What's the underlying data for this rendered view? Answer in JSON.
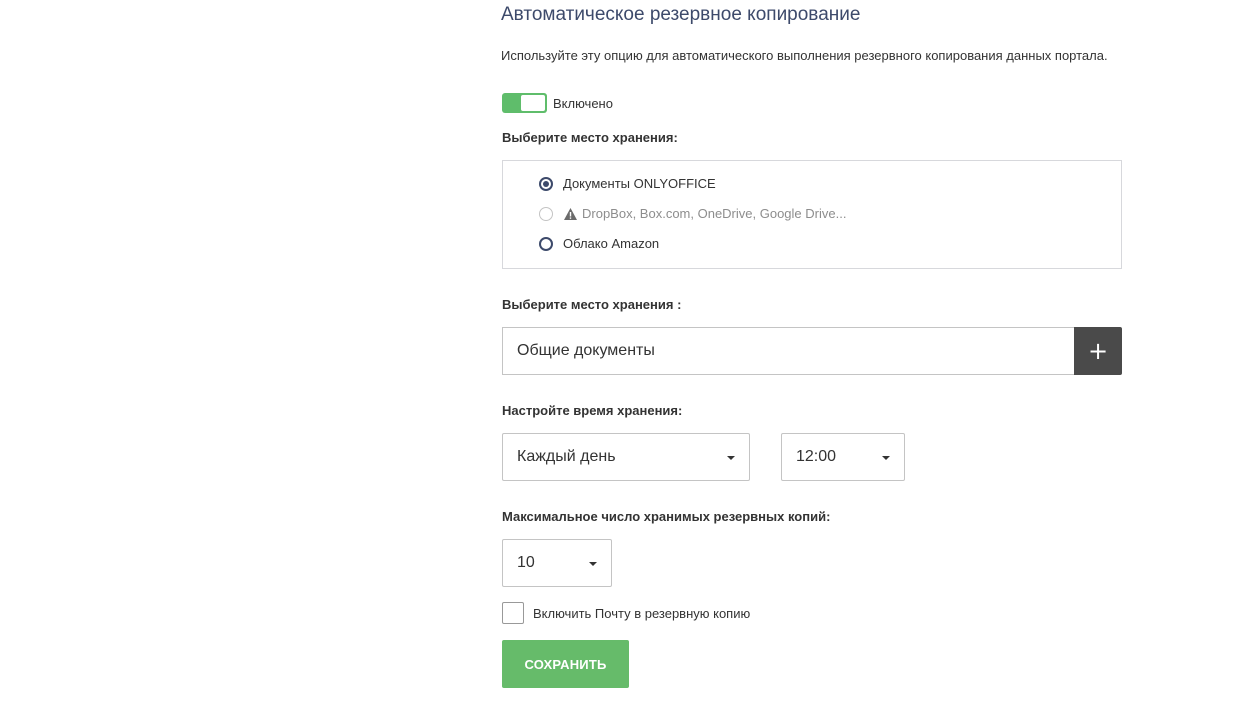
{
  "page": {
    "title": "Автоматическое резервное копирование",
    "description": "Используйте эту опцию для автоматического выполнения резервного копирования данных портала."
  },
  "toggle": {
    "label": "Включено",
    "enabled": true,
    "color": "#5fbd6b"
  },
  "storage": {
    "label": "Выберите место хранения:",
    "options": [
      {
        "label": "Документы ONLYOFFICE",
        "checked": true,
        "disabled": false
      },
      {
        "label": "DropBox, Box.com, OneDrive, Google Drive...",
        "checked": false,
        "disabled": true,
        "icon": "warning-icon"
      },
      {
        "label": "Облако Amazon",
        "checked": false,
        "disabled": false
      }
    ]
  },
  "folder": {
    "label": "Выберите место хранения :",
    "value": "Общие документы",
    "add_label": "+"
  },
  "schedule": {
    "label": "Настройте время хранения:",
    "period": "Каждый день",
    "time": "12:00"
  },
  "max_copies": {
    "label": "Максимальное число хранимых резервных копий:",
    "value": "10"
  },
  "mail_checkbox": {
    "label": "Включить Почту в резервную копию",
    "checked": false
  },
  "save_button": {
    "label": "СОХРАНИТЬ",
    "color": "#66bb6a"
  }
}
